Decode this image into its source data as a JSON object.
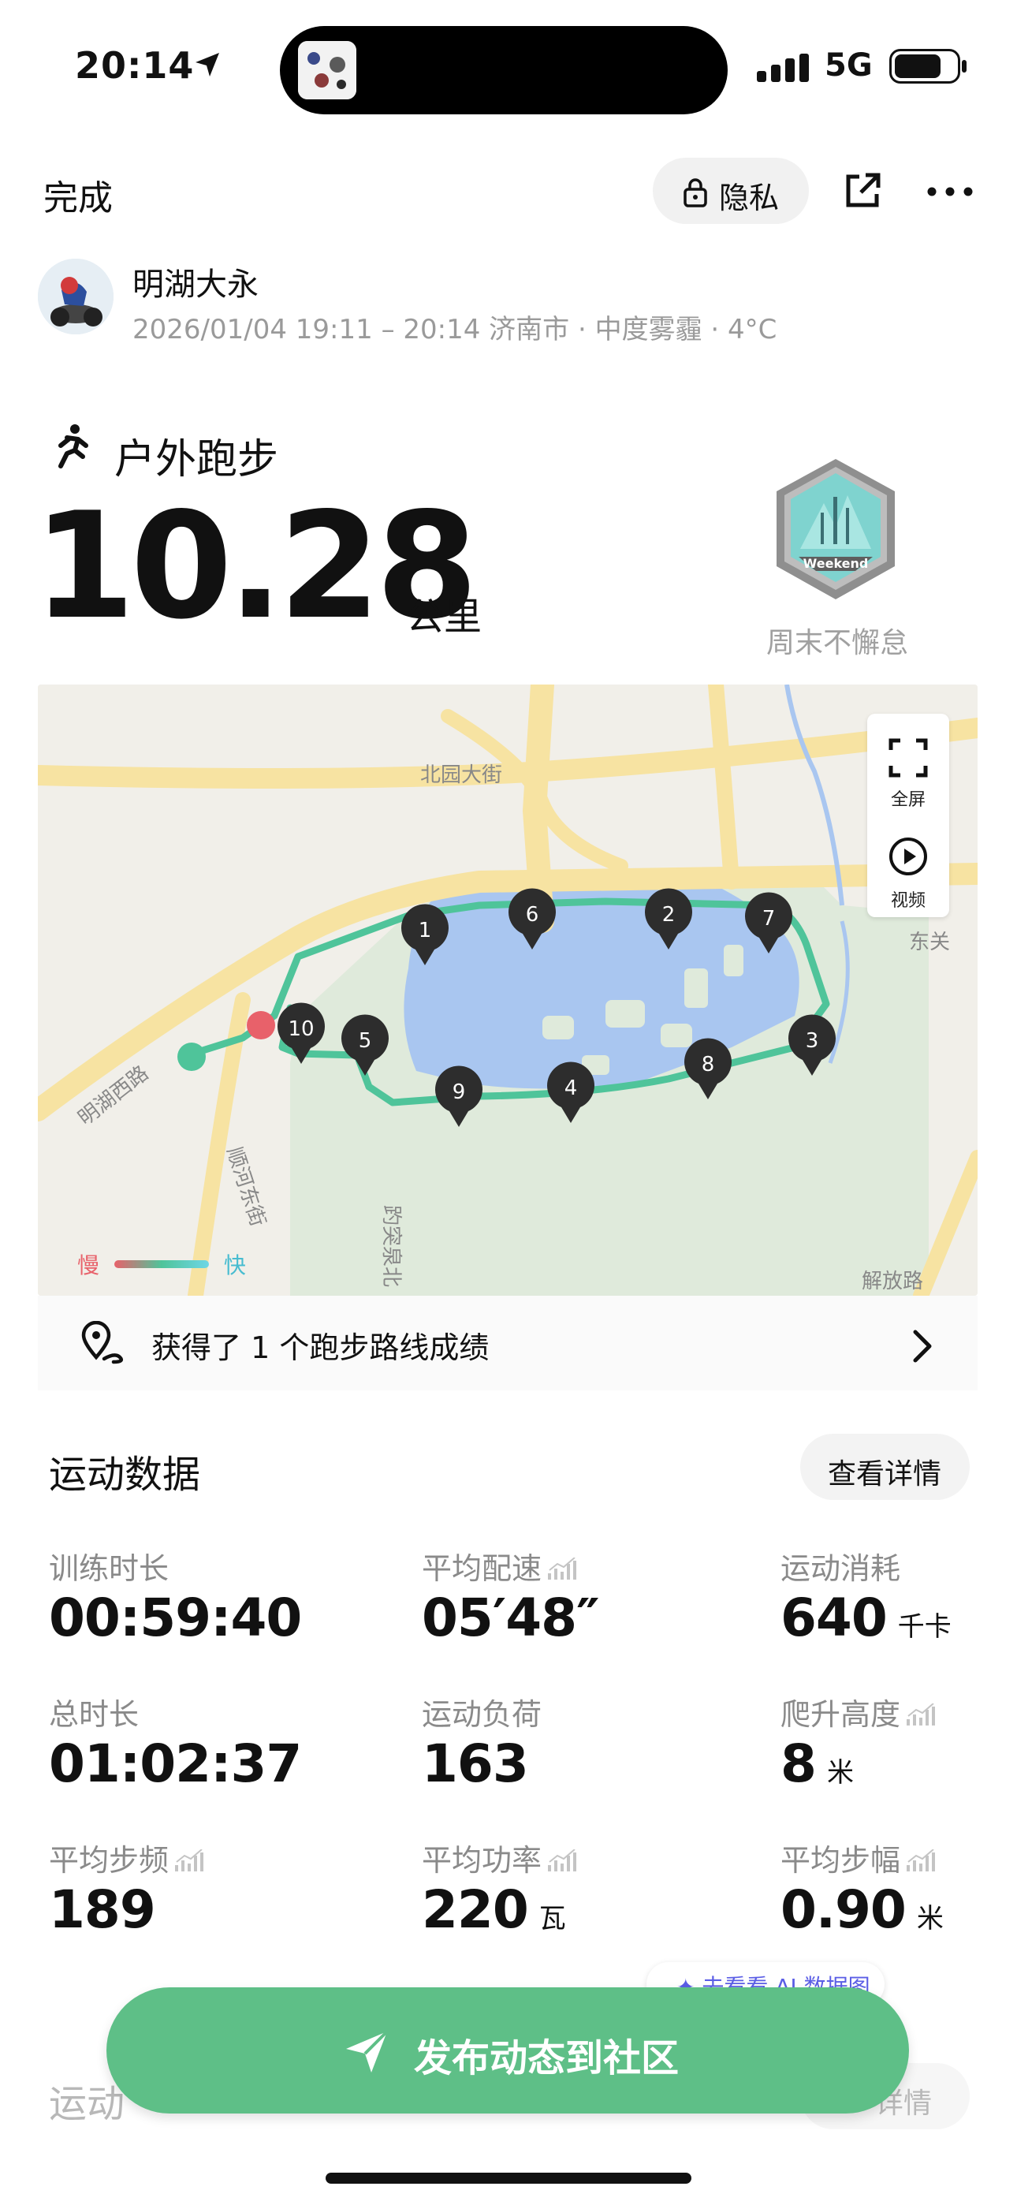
{
  "status_bar": {
    "time": "20:14",
    "network": "5G"
  },
  "header": {
    "done_label": "完成",
    "privacy_label": "隐私"
  },
  "user": {
    "name": "明湖大永",
    "meta": "2026/01/04 19:11 – 20:14 济南市 · 中度雾霾 · 4°C"
  },
  "activity": {
    "type": "户外跑步",
    "distance": "10.28",
    "distance_unit": "公里",
    "badge_text": "Weekend",
    "badge_label": "周末不懈怠"
  },
  "map": {
    "road_labels": [
      "北园大街",
      "东关",
      "明湖西路",
      "顺河东街",
      "趵突泉北",
      "解放路"
    ],
    "controls": {
      "fullscreen": "全屏",
      "video": "视频"
    },
    "legend": {
      "slow": "慢",
      "fast": "快"
    },
    "markers": [
      "1",
      "2",
      "3",
      "4",
      "5",
      "6",
      "7",
      "8",
      "9",
      "10"
    ],
    "colors": {
      "route": "#4fc49a",
      "water": "#a9c6f0",
      "park": "#dfeadb",
      "road": "#f7e3a2"
    }
  },
  "route_achievement": {
    "text": "获得了 1 个跑步路线成绩"
  },
  "stats": {
    "title": "运动数据",
    "detail_label": "查看详情",
    "items": [
      {
        "label": "训练时长",
        "value": "00:59:40",
        "unit": ""
      },
      {
        "label": "平均配速",
        "value": "05′48″",
        "unit": ""
      },
      {
        "label": "运动消耗",
        "value": "640",
        "unit": "千卡"
      },
      {
        "label": "总时长",
        "value": "01:02:37",
        "unit": ""
      },
      {
        "label": "运动负荷",
        "value": "163",
        "unit": ""
      },
      {
        "label": "爬升高度",
        "value": "8",
        "unit": "米"
      },
      {
        "label": "平均步频",
        "value": "189",
        "unit": ""
      },
      {
        "label": "平均功率",
        "value": "220",
        "unit": "瓦"
      },
      {
        "label": "平均步幅",
        "value": "0.90",
        "unit": "米"
      }
    ]
  },
  "ai_link": {
    "label": "去看看 AI 数据图"
  },
  "next_section": {
    "title": "运动",
    "detail": "详情"
  },
  "post_button": {
    "label": "发布动态到社区"
  }
}
